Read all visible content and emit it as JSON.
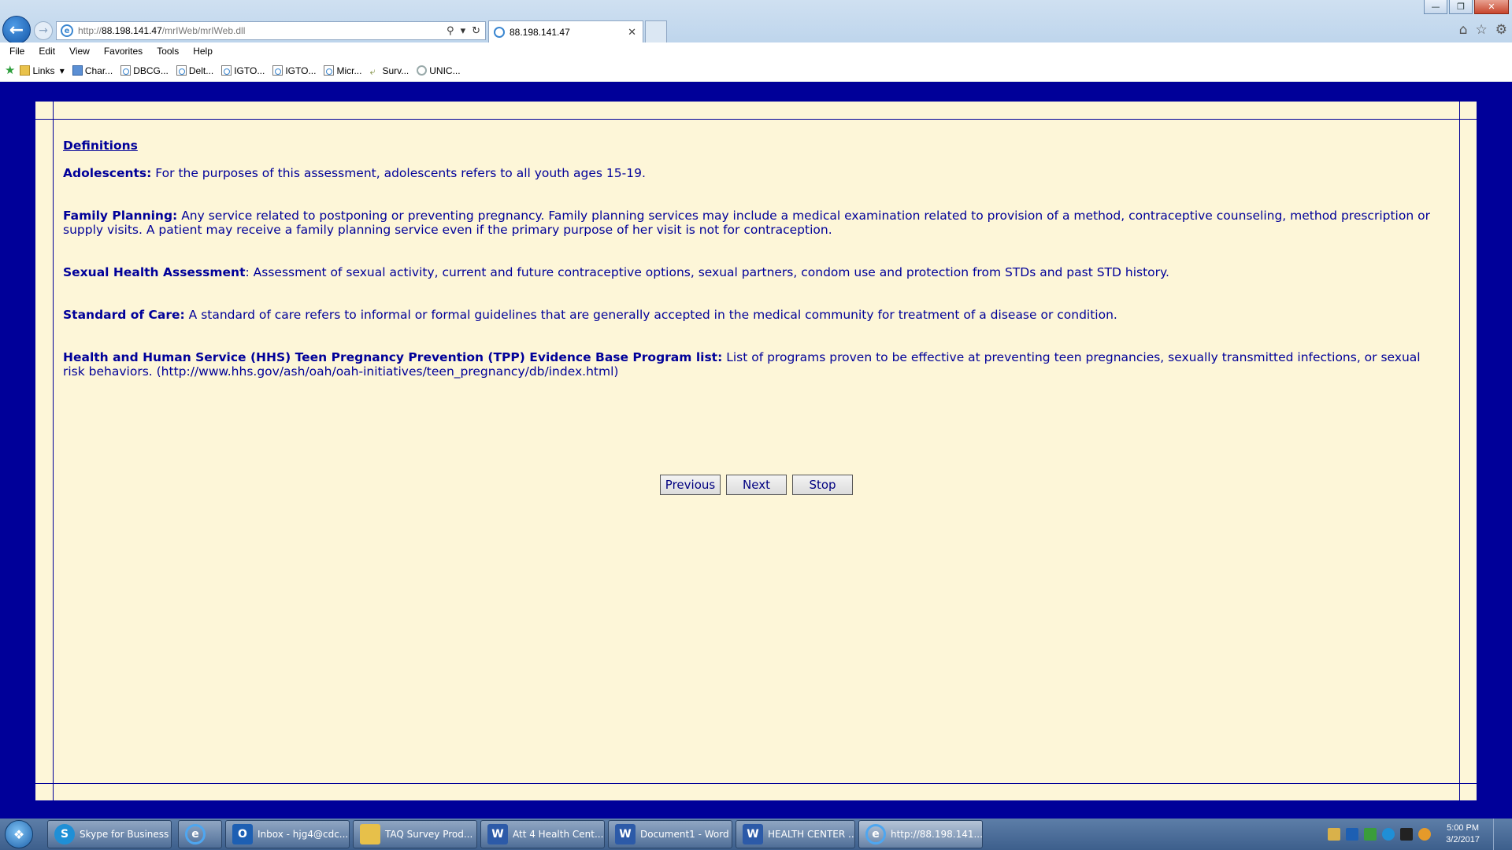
{
  "browser": {
    "url_prefix": "http://",
    "url_host": "88.198.141.47",
    "url_path": "/mrIWeb/mrIWeb.dll",
    "tab_title": "88.198.141.47",
    "menu": [
      "File",
      "Edit",
      "View",
      "Favorites",
      "Tools",
      "Help"
    ],
    "favorites": [
      {
        "label": "Links",
        "icon": "folder-icon"
      },
      {
        "label": "Char...",
        "icon": "chart-icon"
      },
      {
        "label": "DBCG...",
        "icon": "page-icon"
      },
      {
        "label": "Delt...",
        "icon": "page-icon"
      },
      {
        "label": "IGTO...",
        "icon": "page-icon"
      },
      {
        "label": "IGTO...",
        "icon": "page-icon"
      },
      {
        "label": "Micr...",
        "icon": "page-icon"
      },
      {
        "label": "Surv...",
        "icon": "arrow-icon"
      },
      {
        "label": "UNIC...",
        "icon": "globe-icon"
      }
    ]
  },
  "survey": {
    "heading": "Definitions",
    "definitions": [
      {
        "term": "Adolescents:",
        "text": " For the purposes of this assessment, adolescents refers to all youth ages 15-19."
      },
      {
        "term": "Family Planning:",
        "text": " Any service related to postponing or preventing pregnancy. Family planning services may include a medical examination related to provision of a method, contraceptive counseling, method prescription or supply visits. A patient may receive a family planning service even if the primary purpose of her visit is not for contraception."
      },
      {
        "term": "Sexual Health Assessment",
        "text": ": Assessment of sexual activity, current and future contraceptive options, sexual partners, condom use and protection from STDs and past STD history."
      },
      {
        "term": "Standard of Care:",
        "text": " A standard of care refers to informal or formal guidelines that are generally accepted in the medical community for treatment of a disease or condition."
      },
      {
        "term": "Health and Human Service (HHS) Teen Pregnancy Prevention (TPP) Evidence Base Program list:",
        "text": " List of programs proven to be effective at preventing teen pregnancies, sexually transmitted infections, or sexual risk behaviors. (http://www.hhs.gov/ash/oah/oah-initiatives/teen_pregnancy/db/index.html)"
      }
    ],
    "buttons": {
      "previous": "Previous",
      "next": "Next",
      "stop": "Stop"
    }
  },
  "taskbar": {
    "items": [
      {
        "label": "Skype for Business",
        "icon": "skype-icon",
        "glyph": "S"
      },
      {
        "label": "",
        "icon": "ie-icon",
        "glyph": "e"
      },
      {
        "label": "Inbox - hjg4@cdc...",
        "icon": "outlook-icon",
        "glyph": "O"
      },
      {
        "label": "TAQ Survey Prod...",
        "icon": "folder-icon",
        "glyph": ""
      },
      {
        "label": "Att 4 Health Cent...",
        "icon": "word-icon",
        "glyph": "W"
      },
      {
        "label": "Document1 - Word",
        "icon": "word-icon",
        "glyph": "W"
      },
      {
        "label": "HEALTH CENTER ...",
        "icon": "word-icon",
        "glyph": "W"
      },
      {
        "label": "http://88.198.141....",
        "icon": "ie-icon",
        "glyph": "e"
      }
    ],
    "clock_time": "5:00 PM",
    "clock_date": "3/2/2017"
  },
  "colors": {
    "page_background": "#000099",
    "panel_background": "#fdf6d8",
    "text": "#000099"
  }
}
